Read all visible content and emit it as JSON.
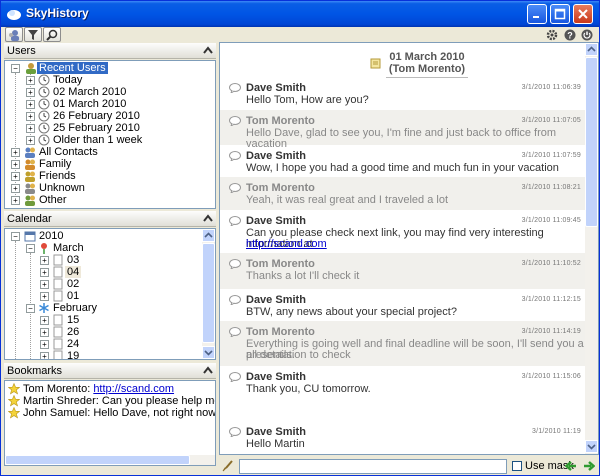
{
  "window": {
    "title": "SkyHistory"
  },
  "users_panel": {
    "title": "Users",
    "root": "Recent Users",
    "recent": [
      "Today",
      "02 March 2010",
      "01 March 2010",
      "26 February 2010",
      "25 February 2010",
      "Older than 1 week"
    ],
    "groups": [
      "All Contacts",
      "Family",
      "Friends",
      "Unknown",
      "Other"
    ]
  },
  "calendar_panel": {
    "title": "Calendar",
    "year": "2010",
    "months": [
      {
        "name": "March",
        "days": [
          "03",
          "04",
          "02",
          "01"
        ]
      },
      {
        "name": "February",
        "days": [
          "15",
          "26",
          "24",
          "19"
        ]
      }
    ]
  },
  "bookmarks_panel": {
    "title": "Bookmarks",
    "items": [
      {
        "who": "Tom Morento:",
        "text": "",
        "link": "http://scand.com"
      },
      {
        "who": "Martin Shreder:",
        "text": "Can you please help me, cannot find",
        "link": ""
      },
      {
        "who": "John Samuel:",
        "text": "Hello Dave, not right now for this mom",
        "link": ""
      }
    ]
  },
  "chat": {
    "date_header": {
      "line1": "01 March 2010",
      "line2": "(Tom Morento)"
    },
    "messages": [
      {
        "who": "Dave Smith",
        "time": "3/1/2010 11:06:39",
        "text": "Hello Tom, How are you?",
        "alt": false
      },
      {
        "who": "Tom Morento",
        "time": "3/1/2010 11:07:05",
        "text": "Hello Dave, glad to see you, I'm fine and just back to office from vacation",
        "alt": true
      },
      {
        "who": "Dave Smith",
        "time": "3/1/2010 11:07:59",
        "text": "Wow, I hope  you had a good time and much fun in your vacation",
        "alt": false
      },
      {
        "who": "Tom Morento",
        "time": "3/1/2010 11:08:21",
        "text": "Yeah, it was real great and I traveled a lot",
        "alt": true
      },
      {
        "who": "Dave Smith",
        "time": "3/1/2010 11:09:45",
        "text": "Can you please check next link, you may find very interesting information at",
        "link": "http://scand.com",
        "alt": false
      },
      {
        "who": "Tom Morento",
        "time": "3/1/2010 11:10:52",
        "text": "Thanks a lot I'll check it",
        "alt": true
      },
      {
        "who": "Dave Smith",
        "time": "3/1/2010 11:12:15",
        "text": "BTW, any news about your special project?",
        "alt": false
      },
      {
        "who": "Tom Morento",
        "time": "3/1/2010 11:14:19",
        "text": "Everything is going well and final deadline will be soon, I'll send you a presentation to check",
        "text2": "all details.",
        "alt": true
      },
      {
        "who": "Dave Smith",
        "time": "3/1/2010 11:15:06",
        "text": "Thank you, CU tomorrow.",
        "alt": false
      },
      {
        "who": "Dave Smith",
        "time": "3/1/2010 11:19",
        "text": "Hello Martin",
        "alt": false
      }
    ]
  },
  "bottom_bar": {
    "search_value": "",
    "use_mask_label": "Use mask"
  },
  "colors": {
    "titlebar": "#0055e5",
    "selection": "#316ac5",
    "link": "#0000d0",
    "alt_row": "#f1f0ec"
  }
}
